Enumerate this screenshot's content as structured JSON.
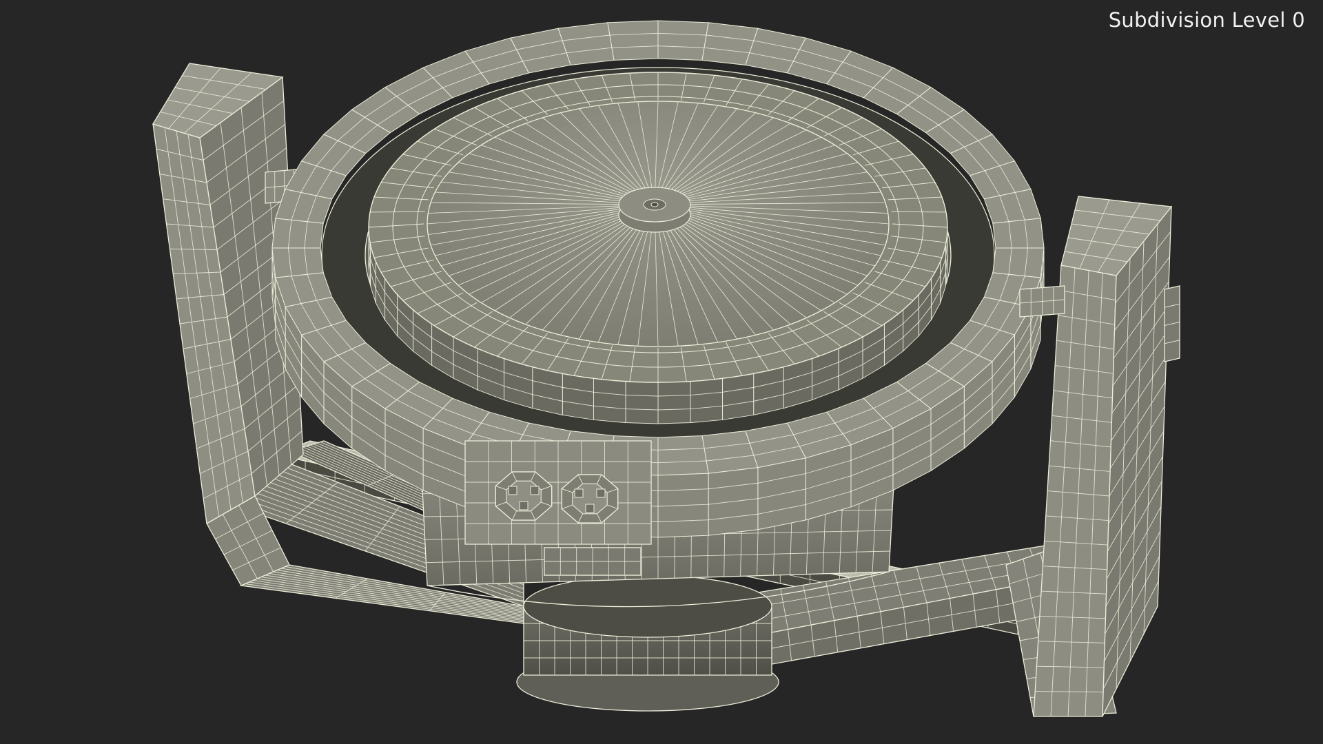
{
  "viewport": {
    "subdivision_label": "Subdivision Level 0",
    "background_color": "#262626",
    "model_fill_color": "#8a8a7e",
    "wire_color": "#ecedd9"
  }
}
